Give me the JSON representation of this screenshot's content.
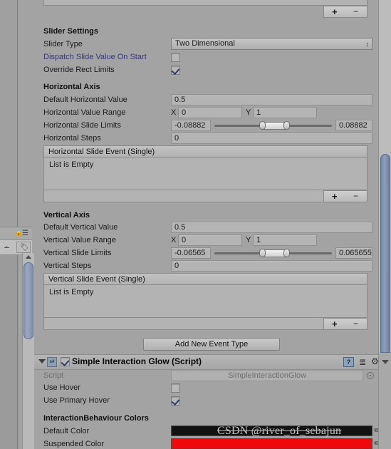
{
  "panel": {
    "top_partial_list": {
      "plus": "+",
      "minus": "−"
    }
  },
  "slider_settings": {
    "header": "Slider Settings",
    "slider_type": {
      "label": "Slider Type",
      "value": "Two Dimensional",
      "arrows": "↕"
    },
    "dispatch_on_start": {
      "label": "Dispatch Slide Value On Start",
      "checked": false
    },
    "override_rect_limits": {
      "label": "Override Rect Limits",
      "checked": true
    }
  },
  "horizontal_axis": {
    "header": "Horizontal Axis",
    "default_value": {
      "label": "Default Horizontal Value",
      "value": "0.5"
    },
    "value_range": {
      "label": "Horizontal Value Range",
      "x_label": "X",
      "x_value": "0",
      "y_label": "Y",
      "y_value": "1"
    },
    "slide_limits": {
      "label": "Horizontal Slide Limits",
      "min": "-0.08882",
      "max": "0.08882"
    },
    "steps": {
      "label": "Horizontal Steps",
      "value": "0"
    },
    "event": {
      "title": "Horizontal Slide Event (Single)",
      "empty_text": "List is Empty",
      "plus": "+",
      "minus": "−"
    }
  },
  "vertical_axis": {
    "header": "Vertical Axis",
    "default_value": {
      "label": "Default Vertical Value",
      "value": "0.5"
    },
    "value_range": {
      "label": "Vertical Value Range",
      "x_label": "X",
      "x_value": "0",
      "y_label": "Y",
      "y_value": "1"
    },
    "slide_limits": {
      "label": "Vertical Slide Limits",
      "min": "-0.06565",
      "max": "0.065655"
    },
    "steps": {
      "label": "Vertical Steps",
      "value": "0"
    },
    "event": {
      "title": "Vertical Slide Event (Single)",
      "empty_text": "List is Empty",
      "plus": "+",
      "minus": "−"
    }
  },
  "add_event_button": {
    "label": "Add New Event Type"
  },
  "glow_component": {
    "title": "Simple Interaction Glow (Script)",
    "enabled": true,
    "script_badge": "c#",
    "help_icon": "?",
    "preset_icon": "preset",
    "gear_icon": "⚙",
    "script": {
      "label": "Script",
      "value": "SimpleInteractionGlow"
    },
    "use_hover": {
      "label": "Use Hover",
      "checked": false
    },
    "use_primary_hover": {
      "label": "Use Primary Hover",
      "checked": true
    },
    "colors_header": "InteractionBehaviour Colors",
    "default_color": {
      "label": "Default Color",
      "hex": "#121212"
    },
    "suspended_color": {
      "label": "Suspended Color",
      "hex": "#ee0a0a"
    }
  },
  "watermark": {
    "text": "CSDN @river_of_sebajun"
  }
}
